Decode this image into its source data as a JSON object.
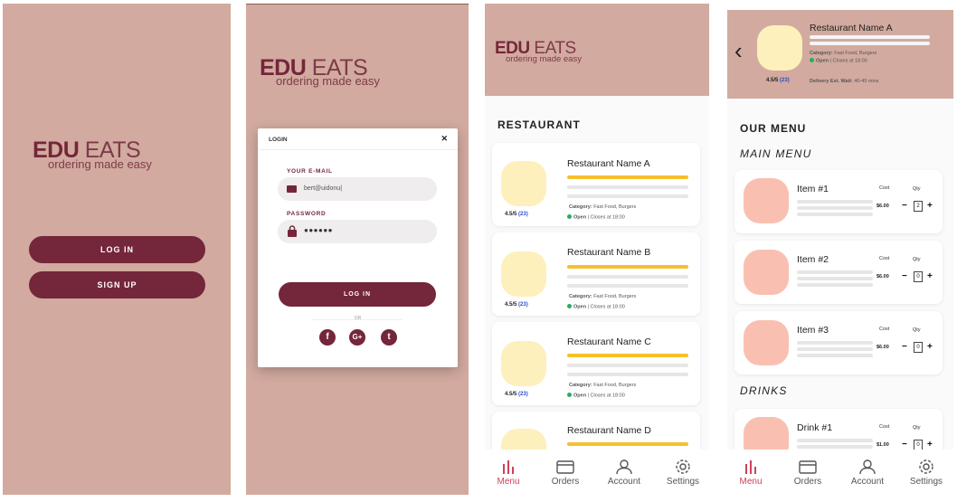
{
  "brand": {
    "name_bold": "EDU",
    "name_light": " EATS",
    "tagline": "ordering made easy"
  },
  "welcome": {
    "login_button": "LOG IN",
    "signup_button": "SIGN UP"
  },
  "login_modal": {
    "title": "LOGIN",
    "close": "✕",
    "email_label": "YOUR E-MAIL",
    "email_value": "bert@uidonu|",
    "password_label": "PASSWORD",
    "password_value": "●●●●●●",
    "submit": "LOG IN",
    "or": "OR",
    "social": [
      "f",
      "G+",
      "t"
    ]
  },
  "restaurants": {
    "heading": "RESTAURANT",
    "items": [
      {
        "name": "Restaurant Name A",
        "rating": "4.5/5",
        "reviews": "(23)",
        "category_label": "Category:",
        "category": " Fast Food, Burgers",
        "status": "Open",
        "hours": " | Closes at 18:00"
      },
      {
        "name": "Restaurant Name B",
        "rating": "4.5/5",
        "reviews": "(23)",
        "category_label": "Category:",
        "category": " Fast Food, Burgers",
        "status": "Open",
        "hours": " | Closes at 18:00"
      },
      {
        "name": "Restaurant Name C",
        "rating": "4.5/5",
        "reviews": "(23)",
        "category_label": "Category:",
        "category": " Fast Food, Burgers",
        "status": "Open",
        "hours": " | Closes at 18:00"
      },
      {
        "name": "Restaurant Name D"
      }
    ]
  },
  "menu_page": {
    "back": "‹",
    "restaurant_name": "Restaurant Name A",
    "category_label": "Category:",
    "category": " Fast Food, Burgers",
    "status": "Open",
    "hours": " | Closes at 18:00",
    "rating": "4.5/5",
    "reviews": "(23)",
    "wait_label": "Delivery Est. Wait:",
    "wait_value": " 40-45 mins",
    "heading": "OUR MENU",
    "main_section": "MAIN MENU",
    "drinks_section": "DRINKS",
    "cost_label": "Cost",
    "qty_label": "Qty",
    "items": [
      {
        "name": "Item #1",
        "price": "$6.00",
        "qty": "2"
      },
      {
        "name": "Item #2",
        "price": "$6.00",
        "qty": "0"
      },
      {
        "name": "Item #3",
        "price": "$6.00",
        "qty": "0"
      }
    ],
    "drinks": [
      {
        "name": "Drink #1",
        "price": "$1.00",
        "qty": "0"
      }
    ],
    "minus": "−",
    "plus": "+"
  },
  "nav": {
    "items": [
      "Menu",
      "Orders",
      "Account",
      "Settings"
    ],
    "active": "Menu"
  },
  "colors": {
    "background": "#d2aa9f",
    "accent": "#74263a",
    "active_nav": "#d0405a",
    "rating_bar": "#f6c02c"
  }
}
